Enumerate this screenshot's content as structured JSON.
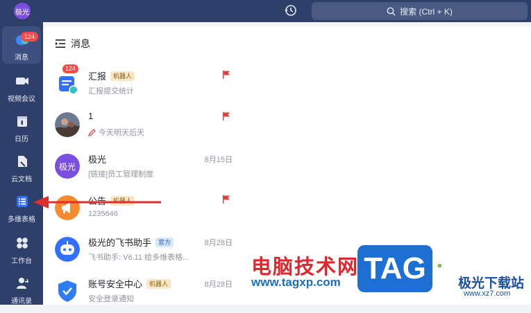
{
  "top": {
    "user_avatar": "极光",
    "search_label": "搜索 (Ctrl + K)"
  },
  "sidebar": {
    "items": [
      {
        "label": "消息",
        "badge": "124",
        "icon": "chat-bubble-icon"
      },
      {
        "label": "视频会议",
        "icon": "video-camera-icon"
      },
      {
        "label": "日历",
        "icon": "calendar-icon"
      },
      {
        "label": "云文档",
        "icon": "document-icon"
      },
      {
        "label": "多维表格",
        "icon": "table-icon"
      },
      {
        "label": "工作台",
        "icon": "grid-icon"
      },
      {
        "label": "通讯录",
        "icon": "contacts-icon"
      }
    ]
  },
  "panel": {
    "title": "消息"
  },
  "chats": [
    {
      "name": "汇报",
      "tag": "机器人",
      "preview": "汇报提交统计",
      "badge": "124",
      "flag": true
    },
    {
      "name": "1",
      "preview": "今天明天后天",
      "flag": true
    },
    {
      "name": "极光",
      "avatar_text": "极光",
      "preview": "[链接]员工管理制度",
      "date": "8月15日"
    },
    {
      "name": "公告",
      "tag": "机器人",
      "preview": "1235646",
      "flag": true
    },
    {
      "name": "极光的飞书助手",
      "tag": "官方",
      "preview": "飞书助手: V6.11 给多维表格...",
      "date": "8月28日"
    },
    {
      "name": "账号安全中心",
      "tag": "机器人",
      "preview": "安全登录通知",
      "date": "8月28日"
    }
  ],
  "watermark": {
    "text": "电脑技术网",
    "url": "www.tagxp.com",
    "tag": "TAG",
    "site_name": "极光下载站",
    "site_url": "www.xz7.com"
  },
  "colors": {
    "sidebar": "#2e3f6a",
    "badge": "#f54a45",
    "flag": "#e03d3d",
    "accent": "#3370ff"
  }
}
